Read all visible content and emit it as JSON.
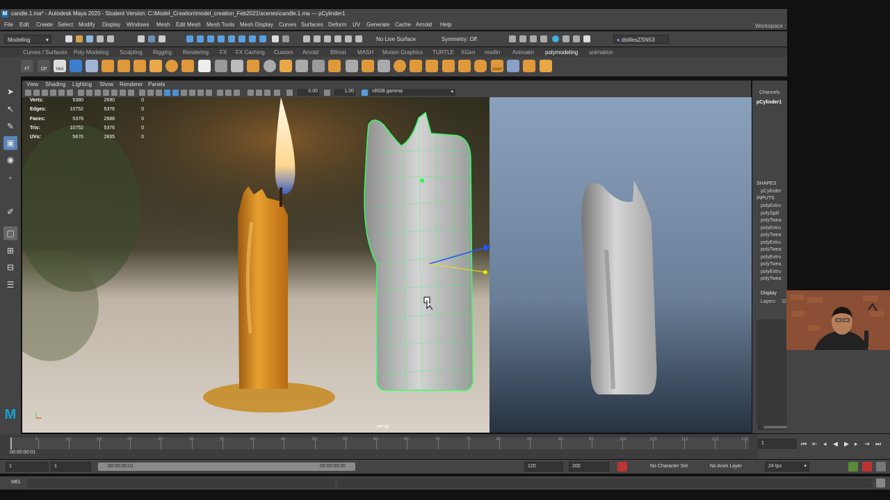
{
  "window": {
    "title": "candle.1.ma* - Autodesk Maya 2020 - Student Version: C:\\Model_Creation\\model_creation_Feb2021\\scenes\\candle.1.ma  ---  pCylinder1"
  },
  "menu": [
    "File",
    "Edit",
    "Create",
    "Select",
    "Modify",
    "Display",
    "Windows",
    "Mesh",
    "Edit Mesh",
    "Mesh Tools",
    "Mesh Display",
    "Curves",
    "Surfaces",
    "Deform",
    "UV",
    "Generate",
    "Cache",
    "Arnold",
    "Help"
  ],
  "workspace_label": "Workspace :",
  "status_line": {
    "mode": "Modeling",
    "live_surface": "No Live Surface",
    "symmetry": "Symmetry: Off",
    "user": "dstilesZSN53"
  },
  "shelf_tabs": [
    "Curves / Surfaces",
    "Poly Modeling",
    "Sculpting",
    "Rigging",
    "Rendering",
    "FX",
    "FX Caching",
    "Custom",
    "Arnold",
    "Bifrost",
    "MASH",
    "Motion Graphics",
    "TURTLE",
    "XGen",
    "modIn",
    "Animatin",
    "polymodeling",
    "animation"
  ],
  "shelf_active_tab": "polymodeling",
  "shelf_icons": {
    "labels": [
      "FT",
      "CP",
      "Hist",
      "12x12"
    ]
  },
  "viewport": {
    "menu": [
      "View",
      "Shading",
      "Lighting",
      "Show",
      "Renderer",
      "Panels"
    ],
    "exposure": "0.00",
    "gamma": "1.00",
    "colorspace": "sRGB gamma",
    "camera_label": "persp"
  },
  "hud": [
    {
      "label": "Verts:",
      "a": "5380",
      "b": "2690",
      "c": "0"
    },
    {
      "label": "Edges:",
      "a": "10752",
      "b": "5376",
      "c": "0"
    },
    {
      "label": "Faces:",
      "a": "5376",
      "b": "2688",
      "c": "0"
    },
    {
      "label": "Tris:",
      "a": "10752",
      "b": "5376",
      "c": "0"
    },
    {
      "label": "UVs:",
      "a": "5670",
      "b": "2835",
      "c": "0"
    }
  ],
  "channel_box": {
    "header": "Channels",
    "object": "pCylinder1",
    "shapes_header": "SHAPES",
    "shape": "pCylinder",
    "inputs_header": "INPUTS",
    "inputs": [
      "polyExtru",
      "polySplit",
      "polyTwea",
      "polyExtru",
      "polyTwea",
      "polyExtru",
      "polyTwea",
      "polyExtru",
      "polyTwea",
      "polyExtru",
      "polyTwea"
    ],
    "display_tab": "Display",
    "layers_label": "Layers",
    "layers_extra": "O"
  },
  "time_slider": {
    "ticks": [
      "5",
      "10",
      "15",
      "20",
      "25",
      "30",
      "35",
      "40",
      "45",
      "50",
      "55",
      "60",
      "65",
      "70",
      "75",
      "80",
      "85",
      "90",
      "95",
      "100",
      "105",
      "110",
      "115",
      "120"
    ],
    "current_time": "00:00:00:01",
    "current_frame": "1"
  },
  "range_slider": {
    "start": "1",
    "inner_start": "1",
    "range_start_time": "00:00:00:01",
    "range_end_time": "00:00:05:00",
    "end": "120",
    "outer_end": "200",
    "character_set": "No Character Set",
    "anim_layer": "No Anim Layer",
    "fps": "24 fps"
  },
  "command_line": {
    "language": "MEL"
  },
  "colors": {
    "panel": "#444444",
    "active_tab": "#ffffff",
    "wireframe": "#33ff66",
    "accent_blue": "#2a6fbf"
  }
}
